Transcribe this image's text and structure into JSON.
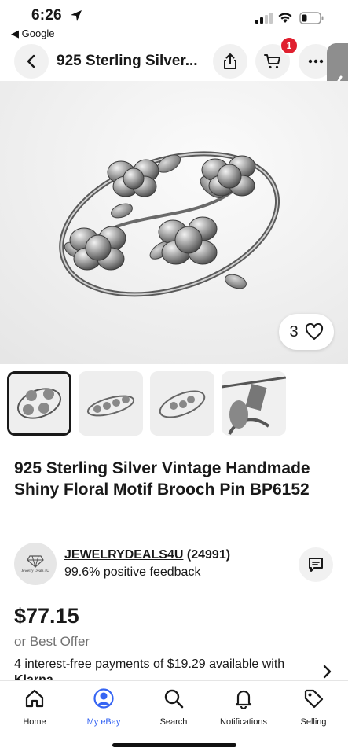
{
  "status_bar": {
    "time": "6:26",
    "back_app": "◀ Google"
  },
  "header": {
    "title": "925 Sterling Silver...",
    "cart_count": "1"
  },
  "hero": {
    "like_count": "3"
  },
  "item": {
    "title": "925 Sterling Silver  Vintage Handmade Shiny Floral Motif Brooch Pin  BP6152"
  },
  "seller": {
    "avatar_text": "Jewelry Deals 4U",
    "username": "JEWELRYDEALS4U",
    "score": "(24991)",
    "feedback": "99.6% positive feedback"
  },
  "pricing": {
    "price": "$77.15",
    "best_offer": "or Best Offer",
    "installments": "4 interest-free payments of $19.29 available with",
    "provider": "Klarna"
  },
  "bottom_nav": {
    "items": [
      {
        "label": "Home",
        "icon": "home-icon"
      },
      {
        "label": "My eBay",
        "icon": "profile-icon"
      },
      {
        "label": "Search",
        "icon": "search-icon"
      },
      {
        "label": "Notifications",
        "icon": "bell-icon"
      },
      {
        "label": "Selling",
        "icon": "tag-icon"
      }
    ],
    "active_index": 1
  },
  "colors": {
    "accent": "#3665f3",
    "badge": "#e0202f",
    "text": "#191919",
    "muted": "#707070"
  }
}
